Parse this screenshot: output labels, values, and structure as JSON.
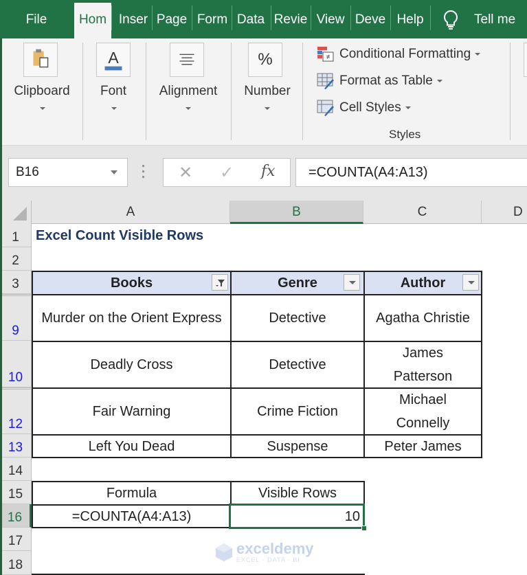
{
  "ribbon_tabs": [
    {
      "label": "File",
      "active": false
    },
    {
      "label": "Hom",
      "active": true
    },
    {
      "label": "Inser",
      "active": false
    },
    {
      "label": "Page",
      "active": false
    },
    {
      "label": "Form",
      "active": false
    },
    {
      "label": "Data",
      "active": false
    },
    {
      "label": "Revie",
      "active": false
    },
    {
      "label": "View",
      "active": false
    },
    {
      "label": "Deve",
      "active": false
    },
    {
      "label": "Help",
      "active": false
    }
  ],
  "tell_me": {
    "label": "Tell me",
    "icon": "lightbulb-icon"
  },
  "ribbon_groups": {
    "clipboard": {
      "label": "Clipboard",
      "icon": "clipboard-icon"
    },
    "font": {
      "label": "Font",
      "icon": "font-color-icon"
    },
    "alignment": {
      "label": "Alignment",
      "icon": "align-center-icon"
    },
    "number": {
      "label": "Number",
      "icon": "percent-icon",
      "glyph": "%"
    },
    "styles": {
      "label": "Styles",
      "items": [
        {
          "label": "Conditional Formatting",
          "icon": "conditional-formatting-icon"
        },
        {
          "label": "Format as Table",
          "icon": "format-as-table-icon"
        },
        {
          "label": "Cell Styles",
          "icon": "cell-styles-icon"
        }
      ]
    }
  },
  "formula_bar": {
    "name_box": "B16",
    "cancel_glyph": "✕",
    "enter_glyph": "✓",
    "fx_label": "fx",
    "formula": "=COUNTA(A4:A13)"
  },
  "columns": [
    "A",
    "B",
    "C",
    "D"
  ],
  "selected_column": "B",
  "rows": {
    "r1": "1",
    "r2": "2",
    "r3": "3",
    "r9": "9",
    "r10": "10",
    "r12": "12",
    "r13": "13",
    "r14": "14",
    "r15": "15",
    "r16": "16",
    "r17": "17",
    "r18": "18"
  },
  "sheet": {
    "title": "Excel Count Visible Rows",
    "table": {
      "headers": [
        "Books",
        "Genre",
        "Author"
      ],
      "header_filters": [
        "filter-applied",
        "dropdown",
        "dropdown"
      ],
      "rows": [
        {
          "row": "9",
          "book": "Murder on the Orient Express",
          "genre": "Detective",
          "author": "Agatha Christie"
        },
        {
          "row": "10",
          "book": "Deadly Cross",
          "genre": "Detective",
          "author": "James Patterson"
        },
        {
          "row": "12",
          "book": "Fair Warning",
          "genre": "Crime Fiction",
          "author": "Michael Connelly"
        },
        {
          "row": "13",
          "book": "Left You Dead",
          "genre": "Suspense",
          "author": "Peter James"
        }
      ]
    },
    "result_table": {
      "headers": [
        "Formula",
        "Visible Rows"
      ],
      "formula_text": "=COUNTA(A4:A13)",
      "value": "10"
    }
  },
  "watermark": {
    "name": "exceldemy",
    "tagline": "EXCEL · DATA · BI"
  },
  "colors": {
    "excel_green": "#217346",
    "table_header_fill": "#d9e1f2",
    "title_text": "#1f3864",
    "filtered_row_number": "#1a1ae6"
  }
}
